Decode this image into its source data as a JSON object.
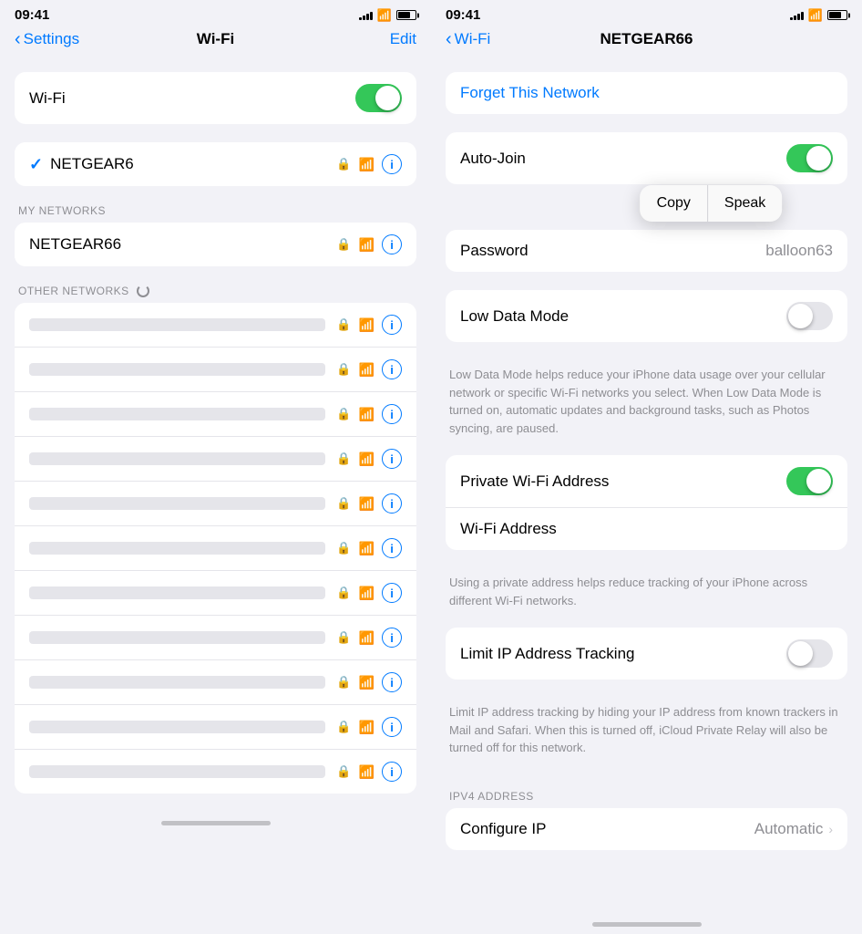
{
  "app": {
    "left": {
      "statusBar": {
        "time": "09:41",
        "signalBars": [
          3,
          5,
          7,
          9,
          11
        ],
        "battery": 70
      },
      "nav": {
        "backLabel": "Settings",
        "title": "Wi-Fi",
        "editLabel": "Edit"
      },
      "wifiToggle": {
        "label": "Wi-Fi",
        "state": "on"
      },
      "connectedNetwork": {
        "name": "NETGEAR6"
      },
      "myNetworksHeader": "MY NETWORKS",
      "myNetworks": [
        {
          "name": "NETGEAR66"
        }
      ],
      "otherNetworksHeader": "OTHER NETWORKS",
      "otherNetworks": 11
    },
    "right": {
      "statusBar": {
        "time": "09:41"
      },
      "nav": {
        "backLabel": "Wi-Fi",
        "title": "NETGEAR66"
      },
      "forgetNetwork": "Forget This Network",
      "autoJoin": {
        "label": "Auto-Join",
        "state": "on"
      },
      "tooltip": {
        "copy": "Copy",
        "speak": "Speak"
      },
      "password": {
        "label": "Password",
        "value": "balloon63"
      },
      "lowDataMode": {
        "label": "Low Data Mode",
        "state": "off",
        "description": "Low Data Mode helps reduce your iPhone data usage over your cellular network or specific Wi-Fi networks you select. When Low Data Mode is turned on, automatic updates and background tasks, such as Photos syncing, are paused."
      },
      "privateWifi": {
        "label": "Private Wi-Fi Address",
        "state": "on"
      },
      "wifiAddress": {
        "label": "Wi-Fi Address",
        "description": "Using a private address helps reduce tracking of your iPhone across different Wi-Fi networks."
      },
      "limitTracking": {
        "label": "Limit IP Address Tracking",
        "state": "off",
        "description": "Limit IP address tracking by hiding your IP address from known trackers in Mail and Safari. When this is turned off, iCloud Private Relay will also be turned off for this network."
      },
      "ipv4Header": "IPV4 ADDRESS",
      "configureIP": {
        "label": "Configure IP",
        "value": "Automatic"
      },
      "homeIndicator": true
    }
  }
}
